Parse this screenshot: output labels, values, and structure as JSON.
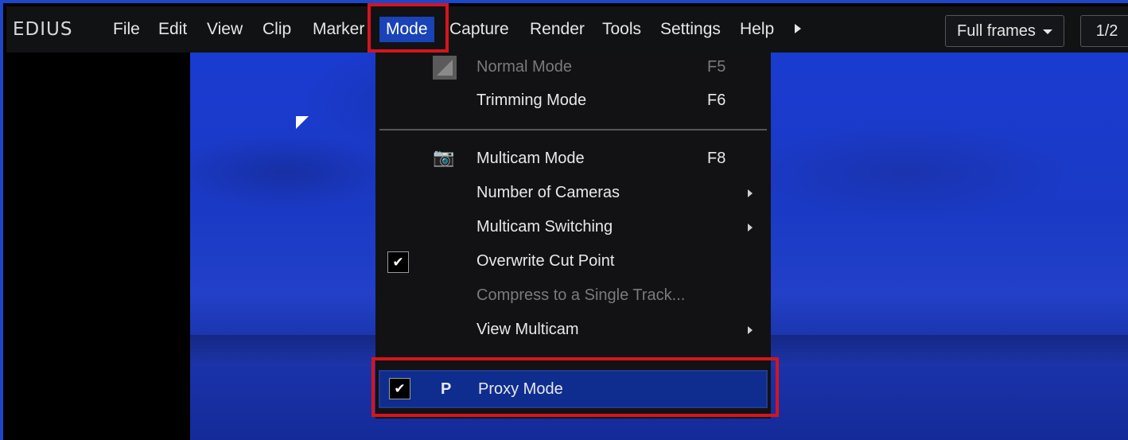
{
  "app": {
    "logo": "EDIUS"
  },
  "menubar": {
    "items": [
      {
        "label": "File"
      },
      {
        "label": "Edit"
      },
      {
        "label": "View"
      },
      {
        "label": "Clip"
      },
      {
        "label": "Marker"
      },
      {
        "label": "Mode"
      },
      {
        "label": "Capture"
      },
      {
        "label": "Render"
      },
      {
        "label": "Tools"
      },
      {
        "label": "Settings"
      },
      {
        "label": "Help"
      }
    ],
    "active": "Mode"
  },
  "toolbar": {
    "frames_dropdown": "Full frames",
    "page": "1/2"
  },
  "mode_menu": {
    "items": [
      {
        "label": "Normal Mode",
        "shortcut": "F5",
        "icon": "normal-mode-icon",
        "state": "disabled"
      },
      {
        "label": "Trimming Mode",
        "shortcut": "F6"
      },
      {
        "label": "Multicam Mode",
        "shortcut": "F8",
        "icon": "multicam-icon"
      },
      {
        "label": "Number of Cameras",
        "submenu": true
      },
      {
        "label": "Multicam Switching",
        "submenu": true
      },
      {
        "label": "Overwrite Cut Point",
        "checked": true
      },
      {
        "label": "Compress to a Single Track...",
        "state": "disabled"
      },
      {
        "label": "View Multicam",
        "submenu": true
      },
      {
        "label": "Proxy Mode",
        "checked": true,
        "icon_glyph": "P",
        "highlighted": true
      }
    ]
  },
  "glyphs": {
    "check": "✔",
    "camera": "📷"
  },
  "colors": {
    "accent": "#1943b6",
    "callout": "#d6141e",
    "menu_bg": "#121214"
  }
}
